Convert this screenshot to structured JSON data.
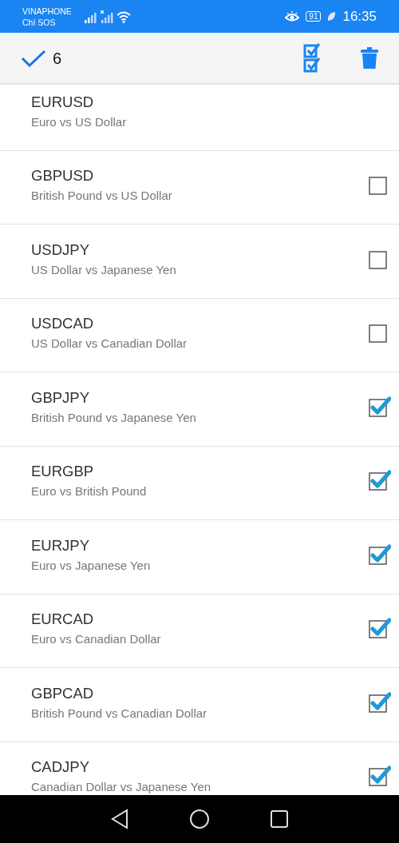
{
  "status_bar": {
    "carrier": "VINAPHONE",
    "carrier_2": "Chí SOS",
    "battery": "91",
    "time": "16:35"
  },
  "toolbar": {
    "count": "6"
  },
  "symbols": [
    {
      "kind": "plain",
      "symbol": "EURUSD",
      "description": "Euro vs US Dollar"
    },
    {
      "kind": "checkable",
      "symbol": "GBPUSD",
      "description": "British Pound vs US Dollar",
      "checked": false
    },
    {
      "kind": "checkable",
      "symbol": "USDJPY",
      "description": "US Dollar vs Japanese Yen",
      "checked": false
    },
    {
      "kind": "checkable",
      "symbol": "USDCAD",
      "description": "US Dollar vs Canadian Dollar",
      "checked": false
    },
    {
      "kind": "checkable",
      "symbol": "GBPJPY",
      "description": "British Pound vs Japanese Yen",
      "checked": true
    },
    {
      "kind": "checkable",
      "symbol": "EURGBP",
      "description": "Euro vs British Pound",
      "checked": true
    },
    {
      "kind": "checkable",
      "symbol": "EURJPY",
      "description": "Euro vs Japanese Yen",
      "checked": true
    },
    {
      "kind": "checkable",
      "symbol": "EURCAD",
      "description": "Euro vs Canadian Dollar",
      "checked": true
    },
    {
      "kind": "checkable",
      "symbol": "GBPCAD",
      "description": "British Pound vs Canadian Dollar",
      "checked": true
    },
    {
      "kind": "checkable",
      "symbol": "CADJPY",
      "description": "Canadian Dollar vs Japanese Yen",
      "checked": true
    }
  ]
}
